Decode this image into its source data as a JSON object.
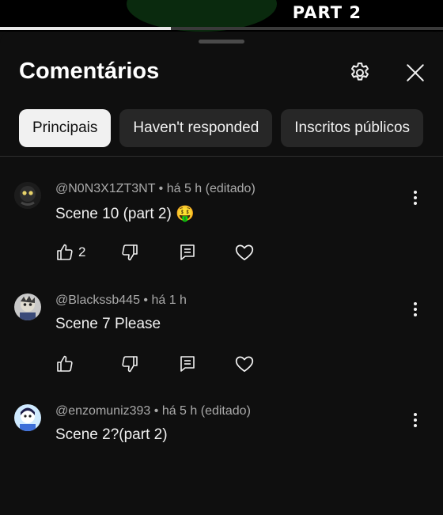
{
  "video": {
    "overlay_text": "PART 2",
    "progress_fraction": 0.385
  },
  "panel": {
    "title": "Comentários",
    "settings_icon": "gear-icon",
    "close_icon": "close-icon"
  },
  "tabs": [
    {
      "label": "Principais",
      "active": true
    },
    {
      "label": "Haven't responded",
      "active": false
    },
    {
      "label": "Inscritos públicos",
      "active": false
    }
  ],
  "comments": [
    {
      "author": "@N0N3X1ZT3NT",
      "time": "há 5 h (editado)",
      "text": "Scene 10 (part 2) 🤑",
      "likes": "2",
      "avatar_color": "#2a2a2a"
    },
    {
      "author": "@Blackssb445",
      "time": "há 1 h",
      "text": "Scene 7 Please",
      "likes": "",
      "avatar_color": "#3a4a5a"
    },
    {
      "author": "@enzomuniz393",
      "time": "há 5 h (editado)",
      "text": "Scene 2?(part 2)",
      "likes": "",
      "avatar_color": "#bfe6ff"
    }
  ],
  "colors": {
    "background": "#0f0f0f",
    "chip_bg": "#272727",
    "chip_active_bg": "#f1f1f1",
    "meta_text": "#aaaaaa"
  }
}
